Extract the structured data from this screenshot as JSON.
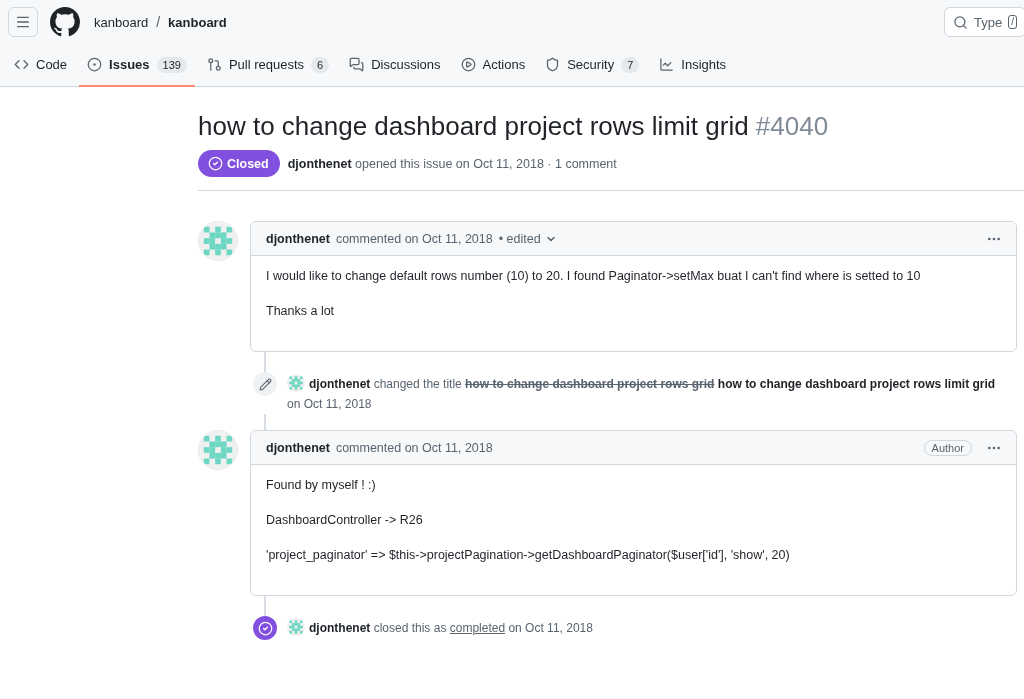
{
  "header": {
    "owner": "kanboard",
    "repo": "kanboard",
    "separator": "/",
    "search_placeholder": "Type",
    "search_key": "/"
  },
  "tabs": [
    {
      "label": "Code",
      "selected": false
    },
    {
      "label": "Issues",
      "count": "139",
      "selected": true
    },
    {
      "label": "Pull requests",
      "count": "6",
      "selected": false
    },
    {
      "label": "Discussions",
      "selected": false
    },
    {
      "label": "Actions",
      "selected": false
    },
    {
      "label": "Security",
      "count": "7",
      "selected": false
    },
    {
      "label": "Insights",
      "selected": false
    }
  ],
  "issue": {
    "title": "how to change dashboard project rows limit grid",
    "number": "#4040",
    "state": "Closed",
    "author": "djonthenet",
    "meta": "opened this issue on Oct 11, 2018 · 1 comment"
  },
  "timeline": [
    {
      "kind": "comment",
      "author": "djonthenet",
      "meta": "commented on Oct 11, 2018",
      "edited": "• edited",
      "paragraphs": [
        "I would like to change default rows number (10) to 20. I found Paginator->setMax buat I can't find where is setted to 10",
        "Thanks a lot"
      ]
    },
    {
      "kind": "renamed",
      "author": "djonthenet",
      "action": "changed the title",
      "old_title": "how to change dashboard project rows grid",
      "new_title": "how to change dashboard project rows limit grid",
      "date": "on Oct 11, 2018"
    },
    {
      "kind": "comment",
      "author": "djonthenet",
      "meta": "commented on Oct 11, 2018",
      "badge": "Author",
      "paragraphs": [
        "Found by myself ! :)",
        "DashboardController -> R26",
        "'project_paginator' => $this->projectPagination->getDashboardPaginator($user['id'], 'show', 20)"
      ]
    },
    {
      "kind": "closed",
      "author": "djonthenet",
      "action": "closed this as",
      "link": "completed",
      "date": "on Oct 11, 2018"
    }
  ]
}
